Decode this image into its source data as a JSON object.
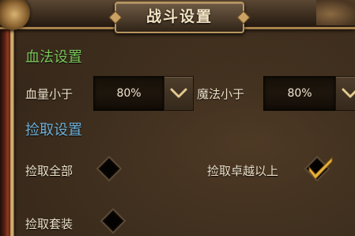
{
  "title": "战斗设置",
  "sections": {
    "hp_mp": {
      "title": "血法设置",
      "hp": {
        "label": "血量小于",
        "value": "80%"
      },
      "mp": {
        "label": "魔法小于",
        "value": "80%"
      }
    },
    "loot": {
      "title": "捡取设置",
      "all": {
        "label": "捡取全部",
        "checked": false
      },
      "excellent": {
        "label": "捡取卓越以上",
        "checked": true
      },
      "set": {
        "label": "捡取套装",
        "checked": false
      }
    }
  },
  "colors": {
    "hp_title": "#7bc65a",
    "loot_title": "#6fb0d6",
    "check_gold": "#e8b23a"
  },
  "icons": {
    "dropdown": "chevron-down-icon",
    "checkbox": "diamond-checkbox-icon",
    "check": "checkmark-icon"
  }
}
